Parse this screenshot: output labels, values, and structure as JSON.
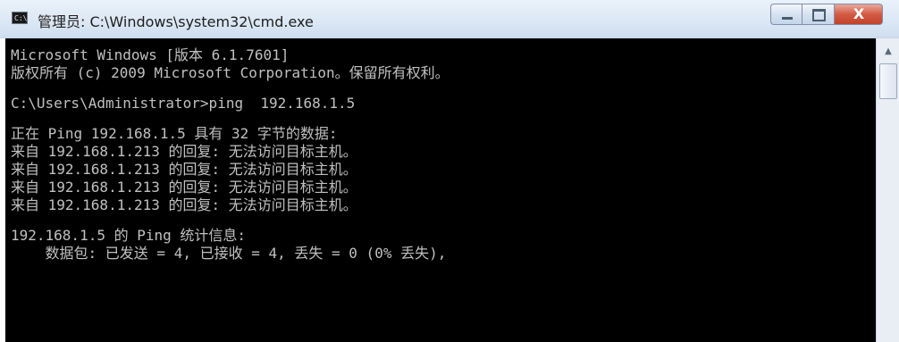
{
  "window": {
    "title": "管理员: C:\\Windows\\system32\\cmd.exe",
    "app_icon_text": "C:\\"
  },
  "controls": {
    "close_glyph": "X"
  },
  "console": {
    "lines": [
      "Microsoft Windows [版本 6.1.7601]",
      "版权所有 (c) 2009 Microsoft Corporation。保留所有权利。",
      "",
      "C:\\Users\\Administrator>ping  192.168.1.5",
      "",
      "正在 Ping 192.168.1.5 具有 32 字节的数据:",
      "来自 192.168.1.213 的回复: 无法访问目标主机。",
      "来自 192.168.1.213 的回复: 无法访问目标主机。",
      "来自 192.168.1.213 的回复: 无法访问目标主机。",
      "来自 192.168.1.213 的回复: 无法访问目标主机。",
      "",
      "192.168.1.5 的 Ping 统计信息:",
      "    数据包: 已发送 = 4, 已接收 = 4, 丢失 = 0 (0% 丢失),"
    ]
  },
  "scrollbar": {
    "up_arrow": "▲"
  }
}
